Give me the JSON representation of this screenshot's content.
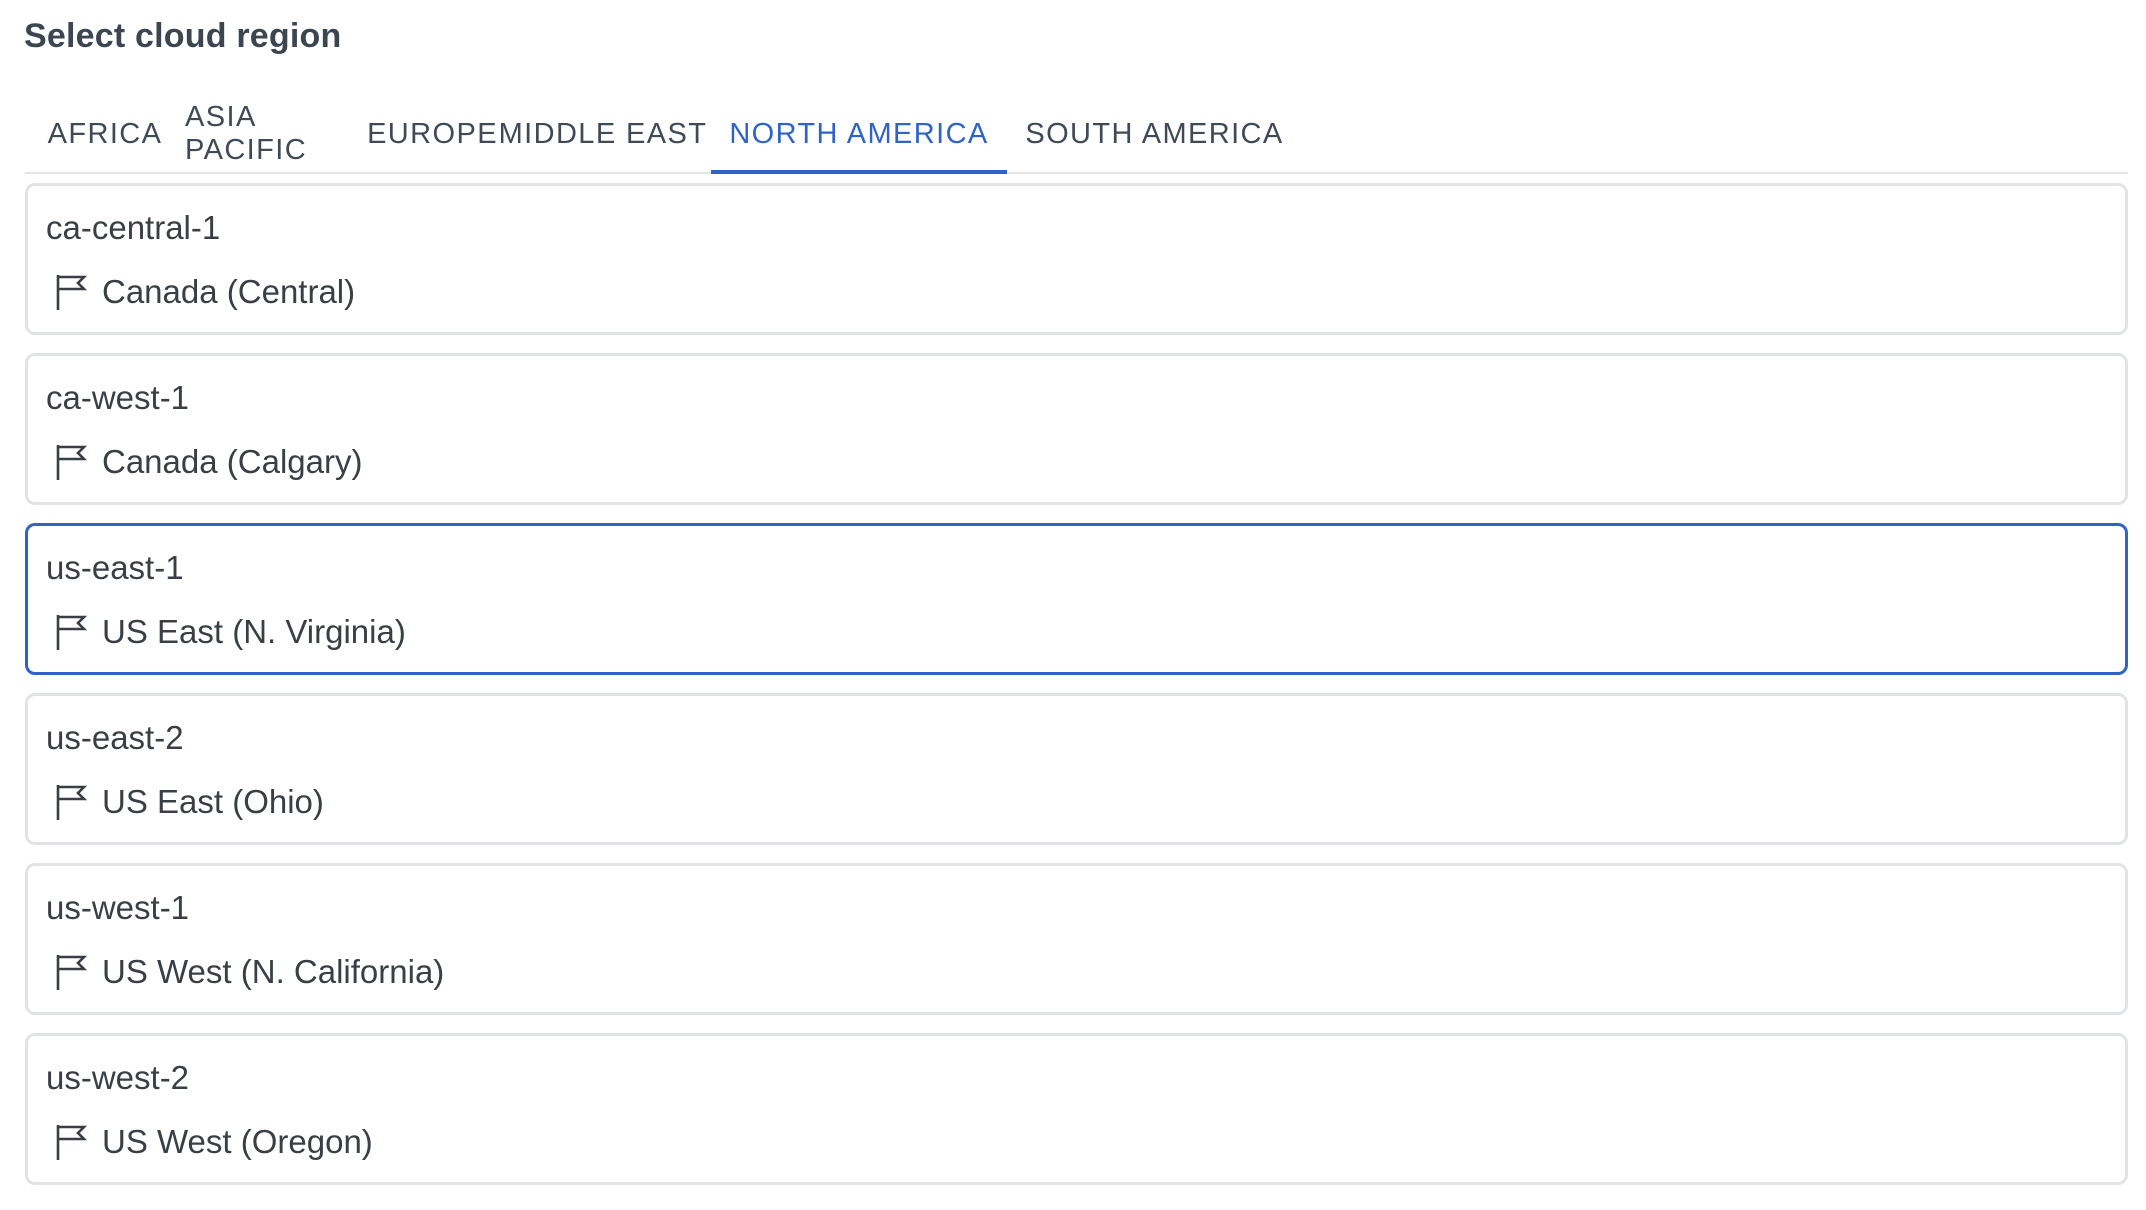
{
  "header": {
    "title": "Select cloud region"
  },
  "tabs": [
    {
      "label": "AFRICA",
      "active": false
    },
    {
      "label": "ASIA PACIFIC",
      "active": false
    },
    {
      "label": "EUROPE",
      "active": false
    },
    {
      "label": "MIDDLE EAST",
      "active": false
    },
    {
      "label": "NORTH AMERICA",
      "active": true
    },
    {
      "label": "SOUTH AMERICA",
      "active": false
    }
  ],
  "regions": [
    {
      "code": "ca-central-1",
      "name": "Canada (Central)",
      "icon": "flag-icon",
      "selected": false
    },
    {
      "code": "ca-west-1",
      "name": "Canada (Calgary)",
      "icon": "flag-icon",
      "selected": false
    },
    {
      "code": "us-east-1",
      "name": "US East (N. Virginia)",
      "icon": "flag-icon",
      "selected": true
    },
    {
      "code": "us-east-2",
      "name": "US East (Ohio)",
      "icon": "flag-icon",
      "selected": false
    },
    {
      "code": "us-west-1",
      "name": "US West (N. California)",
      "icon": "flag-icon",
      "selected": false
    },
    {
      "code": "us-west-2",
      "name": "US West (Oregon)",
      "icon": "flag-icon",
      "selected": false
    }
  ],
  "colors": {
    "accent": "#2f64c6",
    "text": "#3a3f45",
    "border": "#e1e3e6"
  }
}
